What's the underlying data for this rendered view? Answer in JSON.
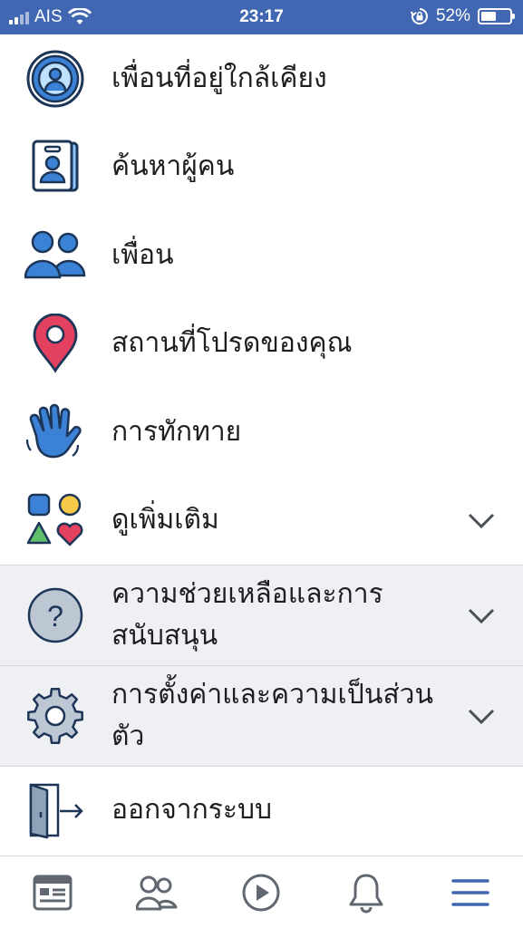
{
  "status_bar": {
    "carrier": "AIS",
    "time": "23:17",
    "battery_percent": "52%",
    "battery_level": 0.52,
    "icons": [
      "signal-icon",
      "wifi-icon",
      "orientation-lock-icon",
      "battery-icon"
    ]
  },
  "menu": {
    "items": [
      {
        "label": "เพื่อนที่อยู่ใกล้เคียง",
        "icon": "nearby-friends-icon"
      },
      {
        "label": "ค้นหาผู้คน",
        "icon": "find-people-icon"
      },
      {
        "label": "เพื่อน",
        "icon": "friends-icon"
      },
      {
        "label": "สถานที่โปรดของคุณ",
        "icon": "location-pin-icon"
      },
      {
        "label": "การทักทาย",
        "icon": "wave-hand-icon"
      },
      {
        "label": "ดูเพิ่มเติม",
        "icon": "shapes-icon"
      }
    ],
    "help": {
      "label": "ความช่วยเหลือและการสนับสนุน",
      "icon": "question-icon"
    },
    "settings": {
      "label": "การตั้งค่าและความเป็นส่วนตัว",
      "icon": "gear-icon"
    },
    "logout": {
      "label": "ออกจากระบบ",
      "icon": "logout-door-icon"
    }
  },
  "tab_bar": {
    "tabs": [
      "news-feed-icon",
      "friends-tab-icon",
      "watch-icon",
      "notifications-bell-icon",
      "menu-hamburger-icon"
    ],
    "active_color": "#4267b2",
    "inactive_color": "#606770"
  },
  "colors": {
    "brand": "#4267b2",
    "section_bg": "#eef0f3",
    "pin_red": "#e4405f"
  }
}
